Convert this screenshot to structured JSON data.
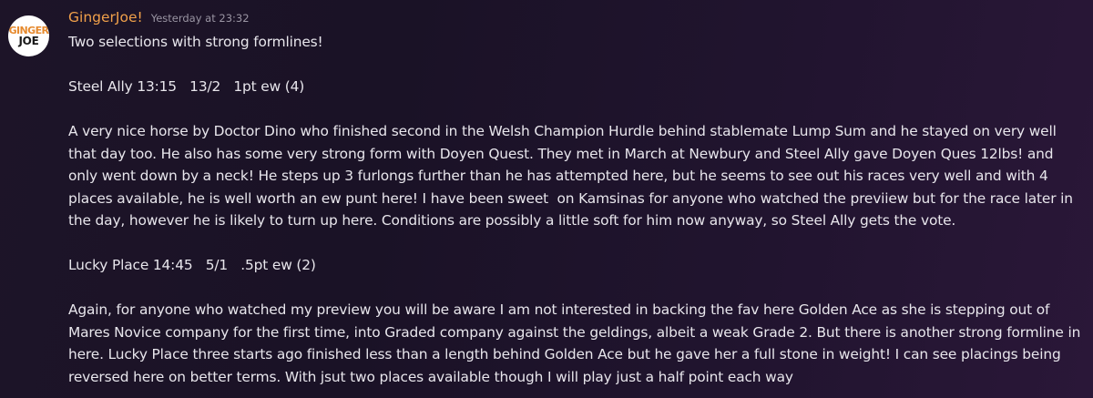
{
  "author": {
    "avatar_line1": "GINGER",
    "avatar_line2": "JOE",
    "username": "GingerJoe!",
    "timestamp": "Yesterday at 23:32"
  },
  "message": {
    "intro": "Two selections with strong formlines!",
    "selection1_header": "Steel Ally 13:15   13/2   1pt ew (4)",
    "selection1_body": "A very nice horse by Doctor Dino who finished second in the Welsh Champion Hurdle behind stablemate Lump Sum and he stayed on very well that day too. He also has some very strong form with Doyen Quest. They met in March at Newbury and Steel Ally gave Doyen Ques 12lbs! and only went down by a neck! He steps up 3 furlongs further than he has attempted here, but he seems to see out his races very well and with 4 places available, he is well worth an ew punt here! I have been sweet  on Kamsinas for anyone who watched the previiew but for the race later in the day, however he is likely to turn up here. Conditions are possibly a little soft for him now anyway, so Steel Ally gets the vote.",
    "selection2_header": "Lucky Place 14:45   5/1   .5pt ew (2)",
    "selection2_body": "Again, for anyone who watched my preview you will be aware I am not interested in backing the fav here Golden Ace as she is stepping out of Mares Novice company for the first time, into Graded company against the geldings, albeit a weak Grade 2. But there is another strong formline in here. Lucky Place three starts ago finished less than a length behind Golden Ace but he gave her a full stone in weight! I can see placings being reversed here on better terms. With jsut two places available though I will play just a half point each way"
  }
}
